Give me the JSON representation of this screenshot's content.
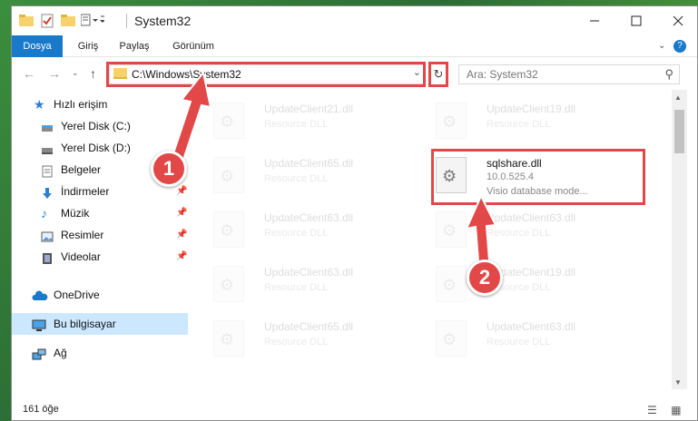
{
  "window": {
    "title": "System32"
  },
  "ribbon": {
    "tabs": [
      "Dosya",
      "Giriş",
      "Paylaş",
      "Görünüm"
    ]
  },
  "address": {
    "path": "C:\\Windows\\System32"
  },
  "search": {
    "placeholder": "Ara: System32"
  },
  "sidebar": {
    "items": [
      {
        "label": "Hızlı erişim"
      },
      {
        "label": "Yerel Disk (C:)"
      },
      {
        "label": "Yerel Disk (D:)"
      },
      {
        "label": "Belgeler"
      },
      {
        "label": "İndirmeler"
      },
      {
        "label": "Müzik"
      },
      {
        "label": "Resimler"
      },
      {
        "label": "Videolar"
      },
      {
        "label": "OneDrive"
      },
      {
        "label": "Bu bilgisayar"
      },
      {
        "label": "Ağ"
      }
    ]
  },
  "files": [
    {
      "name": "UpdateClient21.dll",
      "desc": "Resource DLL"
    },
    {
      "name": "UpdateClient19.dll",
      "desc": "Resource DLL"
    },
    {
      "name": "UpdateClient65.dll",
      "desc": "Resource DLL"
    },
    {
      "name": "sqlshare.dll",
      "version": "10.0.525.4",
      "desc": "Visio database mode..."
    },
    {
      "name": "UpdateClient63.dll",
      "desc": "Resource DLL"
    },
    {
      "name": "UpdateClient63.dll",
      "desc": "Resource DLL"
    },
    {
      "name": "UpdateClient63.dll",
      "desc": "Resource DLL"
    },
    {
      "name": "UpdateClient19.dll",
      "desc": "Resource DLL"
    },
    {
      "name": "UpdateClient65.dll",
      "desc": "Resource DLL"
    },
    {
      "name": "UpdateClient63.dll",
      "desc": "Resource DLL"
    }
  ],
  "status": {
    "count": "161 öğe"
  },
  "annotations": {
    "step1": "1",
    "step2": "2"
  },
  "colors": {
    "accent": "#1979ca",
    "highlight": "#e24848",
    "selected": "#cce8ff"
  }
}
